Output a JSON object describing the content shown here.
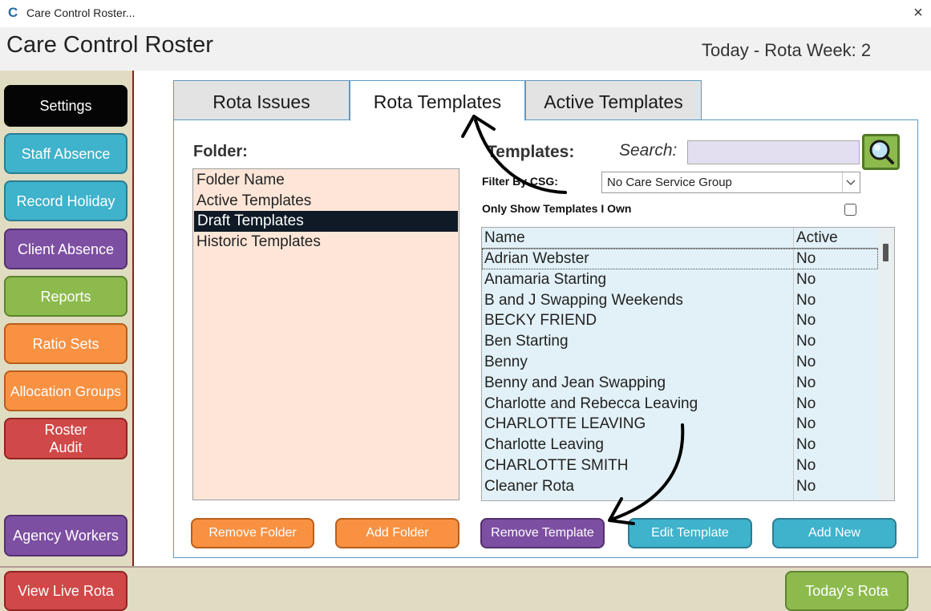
{
  "window": {
    "title": "Care Control Roster...",
    "logo_letter": "C",
    "close_glyph": "×"
  },
  "header": {
    "app_title": "Care Control Roster",
    "rota_week": "Today - Rota Week: 2"
  },
  "sidebar": {
    "items": [
      {
        "label": "Settings"
      },
      {
        "label": "Staff Absence"
      },
      {
        "label": "Record Holiday"
      },
      {
        "label": "Client Absence"
      },
      {
        "label": "Reports"
      },
      {
        "label": "Ratio Sets"
      },
      {
        "label": "Allocation Groups"
      },
      {
        "label": "Roster Audit"
      },
      {
        "label": "Agency Workers"
      }
    ]
  },
  "tabs": [
    {
      "label": "Rota Issues"
    },
    {
      "label": "Rota Templates"
    },
    {
      "label": "Active Templates"
    }
  ],
  "folders": {
    "label": "Folder:",
    "header": "Folder Name",
    "items": [
      "Active Templates",
      "Draft Templates",
      "Historic Templates"
    ],
    "selected": "Draft Templates"
  },
  "templates": {
    "label": "Templates:",
    "search_label": "Search:",
    "search_value": "",
    "filter_label": "Filter By CSG:",
    "filter_value": "No Care Service Group",
    "own_label": "Only Show Templates I Own",
    "own_checked": false,
    "columns": {
      "name": "Name",
      "active": "Active"
    },
    "rows": [
      {
        "name": "Adrian Webster",
        "active": "No"
      },
      {
        "name": "Anamaria Starting",
        "active": "No"
      },
      {
        "name": "B and J Swapping Weekends",
        "active": "No"
      },
      {
        "name": "BECKY FRIEND",
        "active": "No"
      },
      {
        "name": "Ben Starting",
        "active": "No"
      },
      {
        "name": "Benny",
        "active": "No"
      },
      {
        "name": "Benny and Jean Swapping",
        "active": "No"
      },
      {
        "name": "Charlotte and Rebecca Leaving",
        "active": "No"
      },
      {
        "name": "CHARLOTTE LEAVING",
        "active": "No"
      },
      {
        "name": "Charlotte Leaving",
        "active": "No"
      },
      {
        "name": "CHARLOTTE SMITH",
        "active": "No"
      },
      {
        "name": "Cleaner Rota",
        "active": "No"
      }
    ]
  },
  "actions": {
    "remove_folder": "Remove Folder",
    "add_folder": "Add Folder",
    "remove_template": "Remove Template",
    "edit_template": "Edit Template",
    "add_new": "Add New"
  },
  "footer": {
    "view_live_rota": "View Live Rota",
    "todays_rota": "Today's Rota"
  },
  "colors": {
    "sidebar_bg": "#e0dcc2",
    "cyan": "#3fb2cc",
    "purple": "#7d4fa2",
    "green": "#8cba4d",
    "orange": "#f89142",
    "red": "#d04848",
    "folder_bg": "#fde6d8",
    "table_bg": "#e2f1f7"
  },
  "icons": {
    "search": "magnifier-icon",
    "dropdown": "chevron-down-icon",
    "annotation": "curved-arrow-icon"
  }
}
